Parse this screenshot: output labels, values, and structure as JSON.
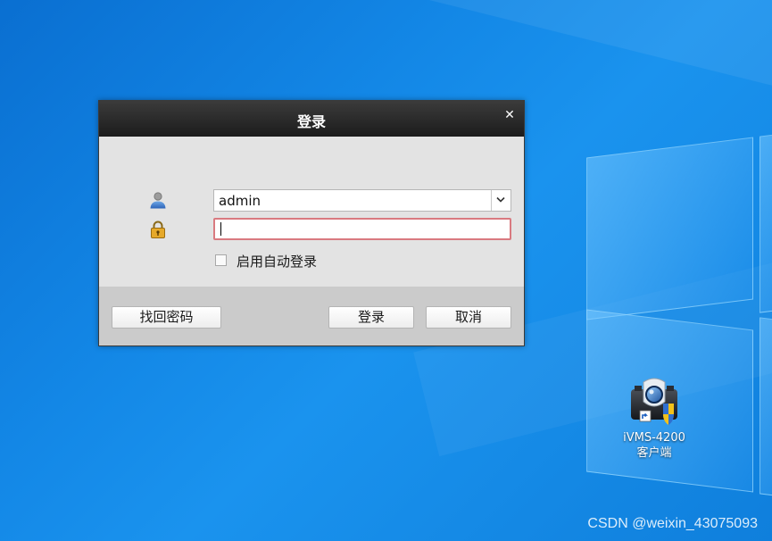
{
  "dialog": {
    "title": "登录",
    "close_icon": "close-icon",
    "username": {
      "value": "admin",
      "icon": "user-icon"
    },
    "password": {
      "value": "",
      "icon": "lock-icon"
    },
    "auto_login_label": "启用自动登录",
    "auto_login_checked": false,
    "buttons": {
      "forgot": "找回密码",
      "login": "登录",
      "cancel": "取消"
    }
  },
  "desktop": {
    "shortcut": {
      "name_line1": "iVMS-4200",
      "name_line2": "客户端",
      "icon": "ivms-camera-icon"
    },
    "watermark": "CSDN @weixin_43075093"
  },
  "colors": {
    "desktop_blue": "#1387e6",
    "titlebar": "#1c1c1c",
    "dialog_bg": "#e3e3e3",
    "footer_bg": "#cbcbcb",
    "password_border": "#d97a80"
  }
}
